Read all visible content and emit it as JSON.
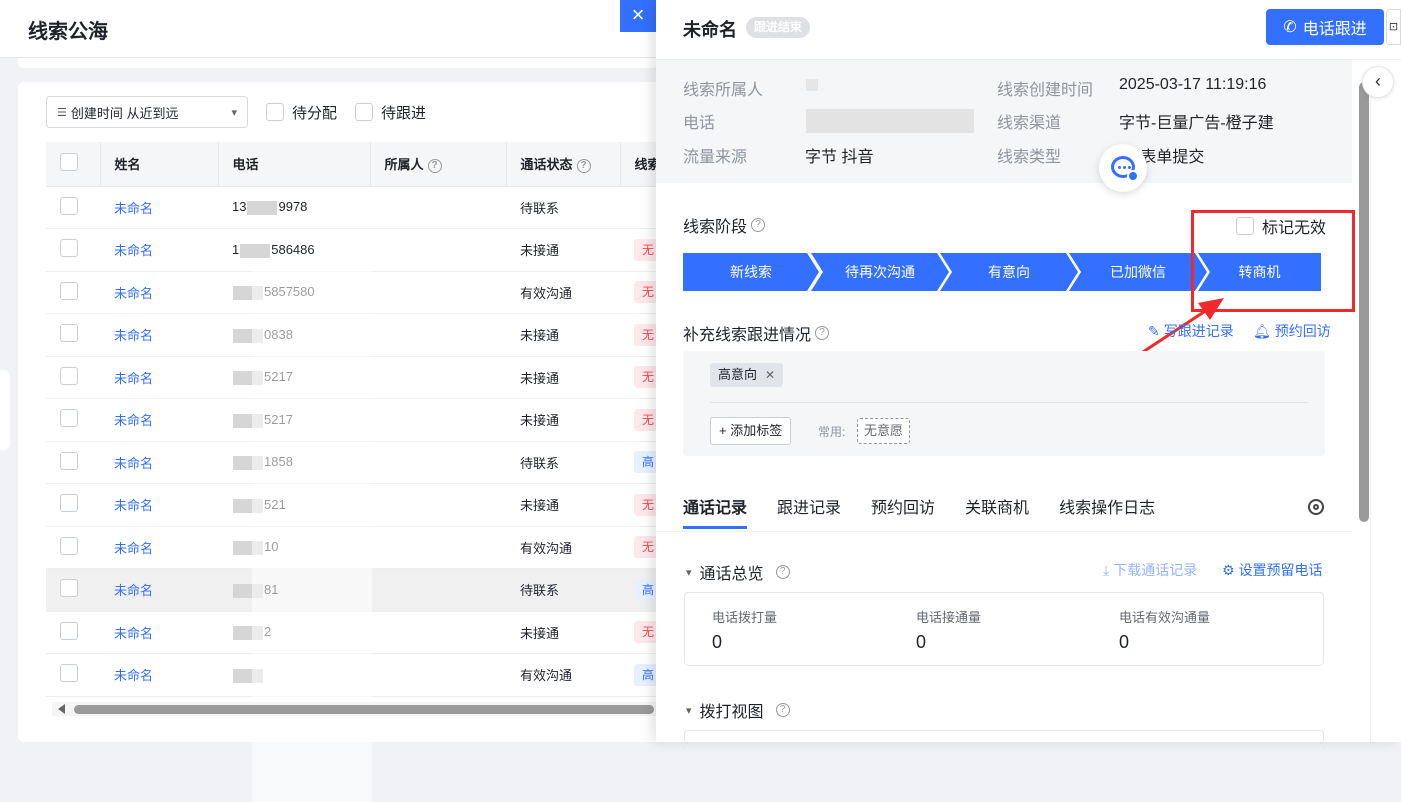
{
  "page": {
    "title": "线索公海"
  },
  "filters": {
    "sort_label": "创建时间 从近到远",
    "unassigned": "待分配",
    "pending_follow": "待跟进"
  },
  "table": {
    "headers": {
      "name": "姓名",
      "phone": "电话",
      "owner": "所属人",
      "call_status": "通话状态",
      "clue": "线索"
    },
    "rows": [
      {
        "name": "未命名",
        "phone_a": "13",
        "phone_b": "9978",
        "status": "待联系",
        "tag": "",
        "tag_color": ""
      },
      {
        "name": "未命名",
        "phone_a": "1",
        "phone_b": "586486",
        "status": "未接通",
        "tag": "无",
        "tag_color": "red"
      },
      {
        "name": "未命名",
        "phone_a": "",
        "phone_b": "5857580",
        "status": "有效沟通",
        "tag": "无",
        "tag_color": "red"
      },
      {
        "name": "未命名",
        "phone_a": "",
        "phone_b": "0838",
        "status": "未接通",
        "tag": "无",
        "tag_color": "red"
      },
      {
        "name": "未命名",
        "phone_a": "",
        "phone_b": "5217",
        "status": "未接通",
        "tag": "无",
        "tag_color": "red"
      },
      {
        "name": "未命名",
        "phone_a": "",
        "phone_b": "5217",
        "status": "未接通",
        "tag": "无",
        "tag_color": "red"
      },
      {
        "name": "未命名",
        "phone_a": "",
        "phone_b": "1858",
        "status": "待联系",
        "tag": "高",
        "tag_color": "blue"
      },
      {
        "name": "未命名",
        "phone_a": "",
        "phone_b": "521",
        "status": "未接通",
        "tag": "无",
        "tag_color": "red"
      },
      {
        "name": "未命名",
        "phone_a": "",
        "phone_b": "10",
        "status": "有效沟通",
        "tag": "无",
        "tag_color": "red"
      },
      {
        "name": "未命名",
        "phone_a": "",
        "phone_b": "81",
        "status": "待联系",
        "tag": "高",
        "tag_color": "blue"
      },
      {
        "name": "未命名",
        "phone_a": "",
        "phone_b": "2",
        "status": "未接通",
        "tag": "无",
        "tag_color": "red"
      },
      {
        "name": "未命名",
        "phone_a": "",
        "phone_b": "",
        "status": "有效沟通",
        "tag": "高",
        "tag_color": "blue"
      }
    ]
  },
  "drawer": {
    "title": "未命名",
    "badge": "跟进结束",
    "call_button": "电话跟进",
    "info": {
      "owner_label": "线索所属人",
      "owner_value": "",
      "created_label": "线索创建时间",
      "created_value": "2025-03-17 11:19:16",
      "phone_label": "电话",
      "phone_value": "",
      "channel_label": "线索渠道",
      "channel_value": "字节-巨量广告-橙子建",
      "source_label": "流量来源",
      "source_value": "字节 抖音",
      "type_label": "线索类型",
      "type_value": "节-表单提交"
    },
    "stage_label": "线索阶段",
    "mark_invalid": "标记无效",
    "stages": [
      "新线索",
      "待再次沟通",
      "有意向",
      "已加微信",
      "转商机"
    ],
    "supplement_label": "补充线索跟进情况",
    "write_record": "写跟进记录",
    "schedule_visit": "预约回访",
    "current_tag": "高意向",
    "add_tag": "添加标签",
    "common_label": "常用:",
    "common_tag": "无意愿",
    "tabs": [
      "通话记录",
      "跟进记录",
      "预约回访",
      "关联商机",
      "线索操作日志"
    ],
    "call_overview": "通话总览",
    "download_records": "下载通话记录",
    "set_reserved_phone": "设置预留电话",
    "stats": [
      {
        "label": "电话拨打量",
        "value": "0"
      },
      {
        "label": "电话接通量",
        "value": "0"
      },
      {
        "label": "电话有效沟通量",
        "value": "0"
      }
    ],
    "dial_view": "拨打视图"
  },
  "colors": {
    "accent": "#3370ff",
    "annotation": "#f02a2a"
  }
}
